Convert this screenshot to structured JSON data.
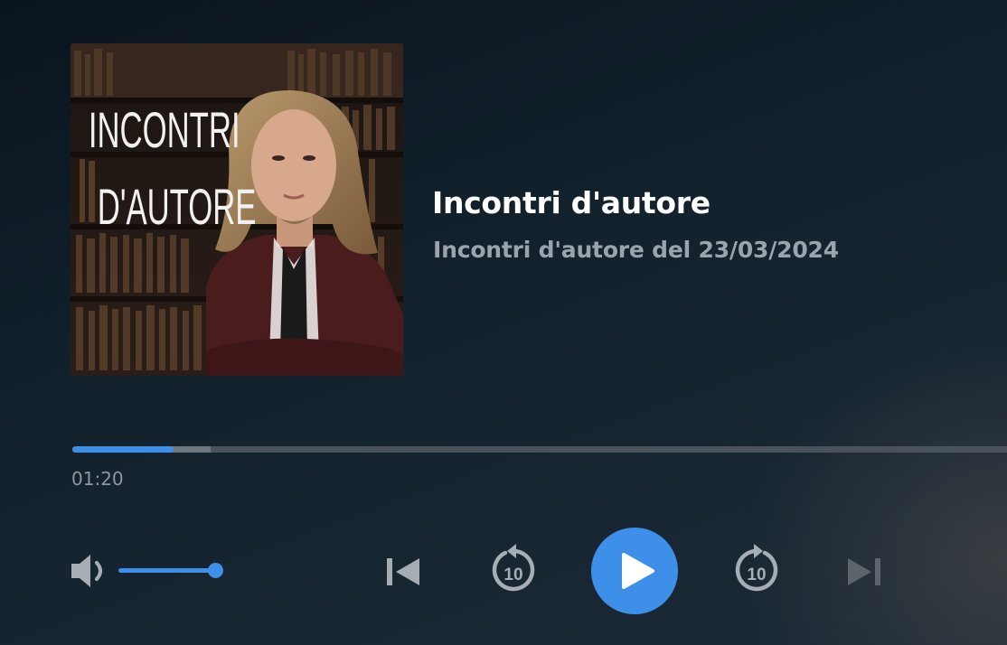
{
  "episode": {
    "cover_text_line1": "INCONTRI",
    "cover_text_line2": "D'AUTORE",
    "title": "Incontri d'autore",
    "subtitle": "Incontri d'autore del 23/03/2024"
  },
  "playback": {
    "elapsed": "01:20",
    "progress_fraction": 0.108,
    "buffered_fraction": 0.148,
    "volume_fraction": 1.0,
    "state": "paused"
  },
  "controls": {
    "volume_icon": "speaker-icon",
    "previous_icon": "skip-previous-icon",
    "rewind_icon": "rewind-10-icon",
    "rewind_label": "10",
    "play_icon": "play-icon",
    "forward_icon": "forward-10-icon",
    "forward_label": "10",
    "next_icon": "skip-next-icon"
  },
  "colors": {
    "accent": "#3d8fe8",
    "muted_text": "#9ba3ad",
    "disabled_icon": "#5d646b",
    "icon": "#a7adb4"
  }
}
